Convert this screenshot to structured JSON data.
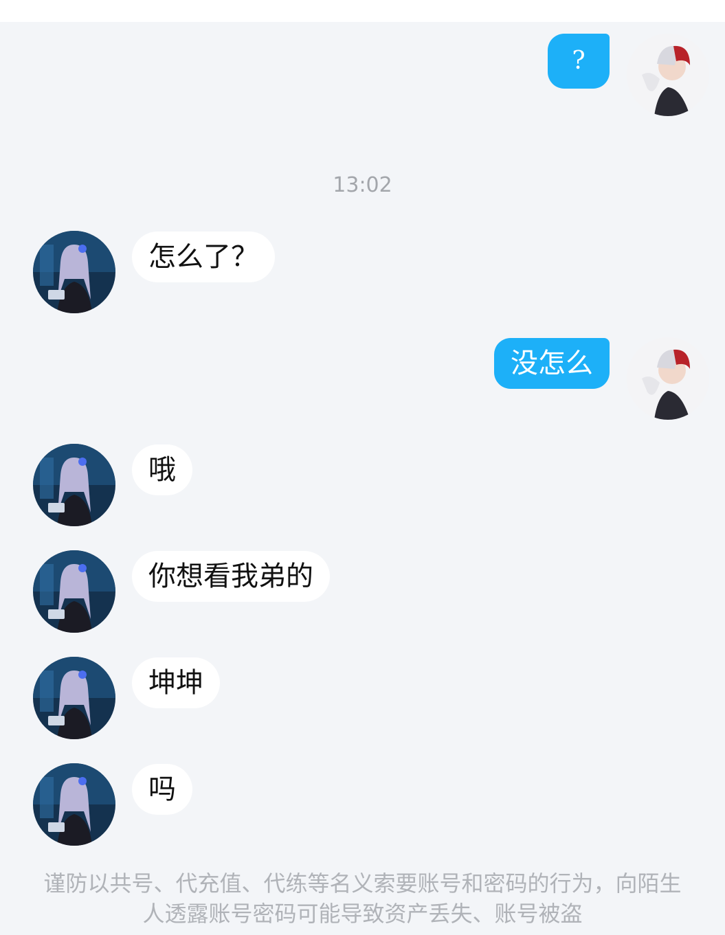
{
  "messages": [
    {
      "side": "me",
      "text": "?"
    },
    {
      "side": "peer",
      "text": "怎么了？"
    },
    {
      "side": "me",
      "text": "没怎么"
    },
    {
      "side": "peer",
      "text": "哦"
    },
    {
      "side": "peer",
      "text": "你想看我弟的"
    },
    {
      "side": "peer",
      "text": "坤坤"
    },
    {
      "side": "peer",
      "text": "吗"
    }
  ],
  "timestamp": "13:02",
  "notice": "谨防以共号、代充值、代练等名义索要账号和密码的行为，向陌生人透露账号密码可能导致资产丢失、账号被盗",
  "colors": {
    "background": "#f3f5f8",
    "my_bubble": "#1db0f8",
    "peer_bubble": "#ffffff",
    "timestamp": "#a3a6ab"
  },
  "avatars": {
    "me": "user-avatar-icon",
    "peer": "contact-avatar-icon"
  }
}
